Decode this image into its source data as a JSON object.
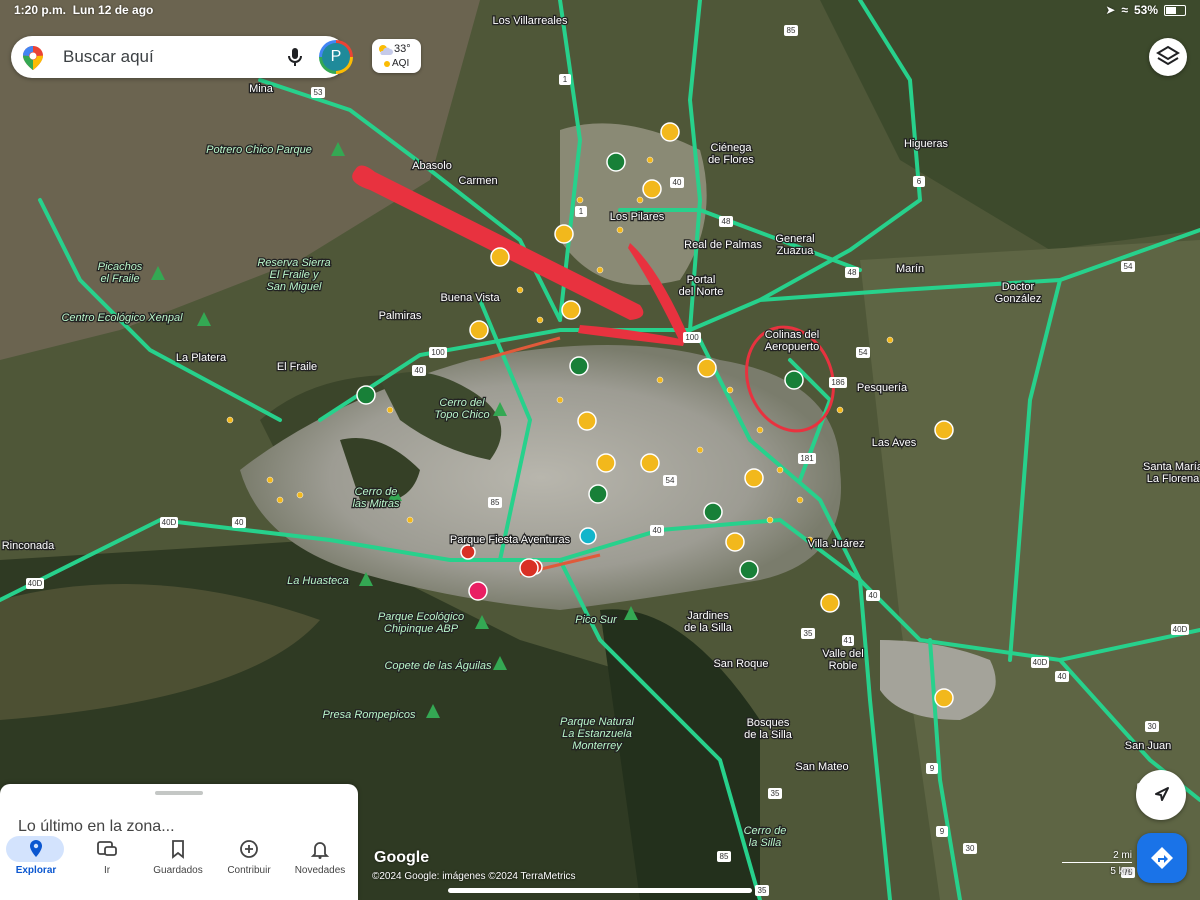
{
  "status_bar": {
    "time": "1:20 p.m.",
    "date": "Lun 12 de ago",
    "battery": "53%"
  },
  "search": {
    "placeholder": "Buscar aquí"
  },
  "account": {
    "initial": "P"
  },
  "weather": {
    "temperature": "33°",
    "aqi_label": "AQI",
    "aqi_color": "#fbbc04"
  },
  "map": {
    "colors": {
      "highway": "#27d18c",
      "annotation": "#e8323f",
      "urban": "#a9a8a0",
      "terrain": "#4a5236"
    },
    "labels": [
      {
        "id": "los-villarreales",
        "text": "Los Villarreales"
      },
      {
        "id": "mina",
        "text": "Mina"
      },
      {
        "id": "potrero-chico",
        "text": "Potrero Chico Parque"
      },
      {
        "id": "abasolo",
        "text": "Abasolo"
      },
      {
        "id": "carmen",
        "text": "Carmen"
      },
      {
        "id": "cienega",
        "text": "Ciénega\nde Flores"
      },
      {
        "id": "higueras",
        "text": "Higueras"
      },
      {
        "id": "los-pilares",
        "text": "Los Pilares"
      },
      {
        "id": "real-de-palmas",
        "text": "Real de Palmas"
      },
      {
        "id": "general-zuazua",
        "text": "General\nZuazua"
      },
      {
        "id": "marin",
        "text": "Marín"
      },
      {
        "id": "doctor-gonzalez",
        "text": "Doctor\nGonzález"
      },
      {
        "id": "reserva",
        "text": "Reserva Sierra\nEl Fraile y\nSan Miguel"
      },
      {
        "id": "picachos",
        "text": "Picachos\nel Fraile"
      },
      {
        "id": "buena-vista",
        "text": "Buena Vista"
      },
      {
        "id": "portal-del-norte",
        "text": "Portal\ndel Norte"
      },
      {
        "id": "centro-ecologico",
        "text": "Centro Ecológico Xenpal"
      },
      {
        "id": "palmiras",
        "text": "Palmiras"
      },
      {
        "id": "colinas",
        "text": "Colinas del\nAeropuerto"
      },
      {
        "id": "la-platera",
        "text": "La Platera"
      },
      {
        "id": "el-fraile",
        "text": "El Fraile"
      },
      {
        "id": "pesqueria",
        "text": "Pesquería"
      },
      {
        "id": "cerro-topo-chico",
        "text": "Cerro del\nTopo Chico"
      },
      {
        "id": "las-aves",
        "text": "Las Aves"
      },
      {
        "id": "santa-maria",
        "text": "Santa María\nLa Florena"
      },
      {
        "id": "cerro-mitras",
        "text": "Cerro de\nlas Mitras"
      },
      {
        "id": "rinconada",
        "text": "Rinconada"
      },
      {
        "id": "parque-fiesta",
        "text": "Parque Fiesta Aventuras"
      },
      {
        "id": "villa-juarez",
        "text": "Villa Juárez"
      },
      {
        "id": "la-huasteca",
        "text": "La Huasteca"
      },
      {
        "id": "parque-chipinque",
        "text": "Parque Ecológico\nChipinque ABP"
      },
      {
        "id": "pico-sur",
        "text": "Pico Sur"
      },
      {
        "id": "jardines",
        "text": "Jardines\nde la Silla"
      },
      {
        "id": "valle-del-roble",
        "text": "Valle del\nRoble"
      },
      {
        "id": "copete",
        "text": "Copete de las Águilas"
      },
      {
        "id": "san-roque",
        "text": "San Roque"
      },
      {
        "id": "presa",
        "text": "Presa Rompepicos"
      },
      {
        "id": "parque-estanzuela",
        "text": "Parque Natural\nLa Estanzuela\nMonterrey"
      },
      {
        "id": "bosques",
        "text": "Bosques\nde la Silla"
      },
      {
        "id": "san-juan",
        "text": "San Juan"
      },
      {
        "id": "san-mateo",
        "text": "San Mateo"
      },
      {
        "id": "cerro-silla",
        "text": "Cerro de\nla Silla"
      }
    ],
    "shields": [
      "53",
      "1",
      "85",
      "1",
      "40",
      "48",
      "48",
      "54",
      "100",
      "100",
      "40",
      "54",
      "186",
      "181",
      "54",
      "85",
      "40D",
      "40",
      "40D",
      "40",
      "41",
      "35",
      "40D",
      "40",
      "30",
      "9",
      "75",
      "9",
      "35",
      "85",
      "30",
      "75",
      "35",
      "6",
      "54"
    ]
  },
  "bottom_sheet": {
    "title": "Lo último en la zona..."
  },
  "nav": {
    "items": [
      {
        "label": "Explorar",
        "icon": "explore-pin-icon",
        "active": true
      },
      {
        "label": "Ir",
        "icon": "commute-icon",
        "active": false
      },
      {
        "label": "Guardados",
        "icon": "bookmark-icon",
        "active": false
      },
      {
        "label": "Contribuir",
        "icon": "add-circle-icon",
        "active": false
      },
      {
        "label": "Novedades",
        "icon": "bell-icon",
        "active": false
      }
    ]
  },
  "attribution": {
    "logo": "Google",
    "credits": "©2024 Google: imágenes ©2024 TerraMetrics"
  },
  "scale": {
    "miles": "2 mi",
    "km": "5 km"
  }
}
